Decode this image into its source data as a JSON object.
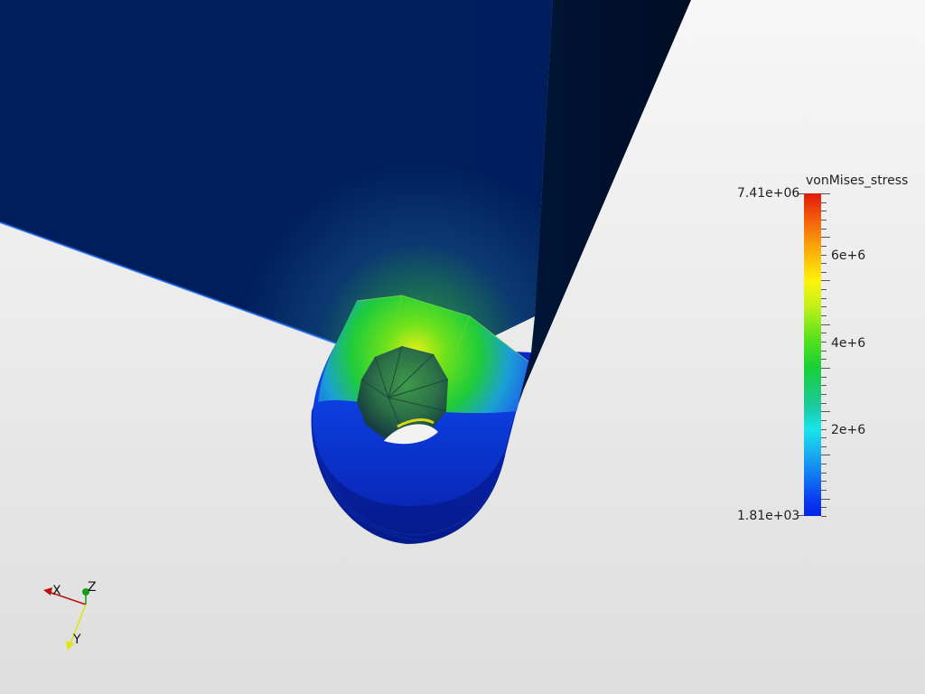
{
  "scalar_bar": {
    "title": "vonMises_stress",
    "max_label": "7.41e+06",
    "min_label": "1.81e+03",
    "labels": [
      "6e+6",
      "4e+6",
      "2e+6"
    ]
  },
  "axes": {
    "x_label": "X",
    "y_label": "Y",
    "z_label": "Z"
  },
  "colors": {
    "background_top": "#f7f7f7",
    "background_bottom": "#dedede",
    "low_stress": "#0222e8",
    "high_stress": "#e01a0b",
    "axis_x": "#c01010",
    "axis_y": "#e2e20c",
    "axis_z": "#10a010"
  }
}
